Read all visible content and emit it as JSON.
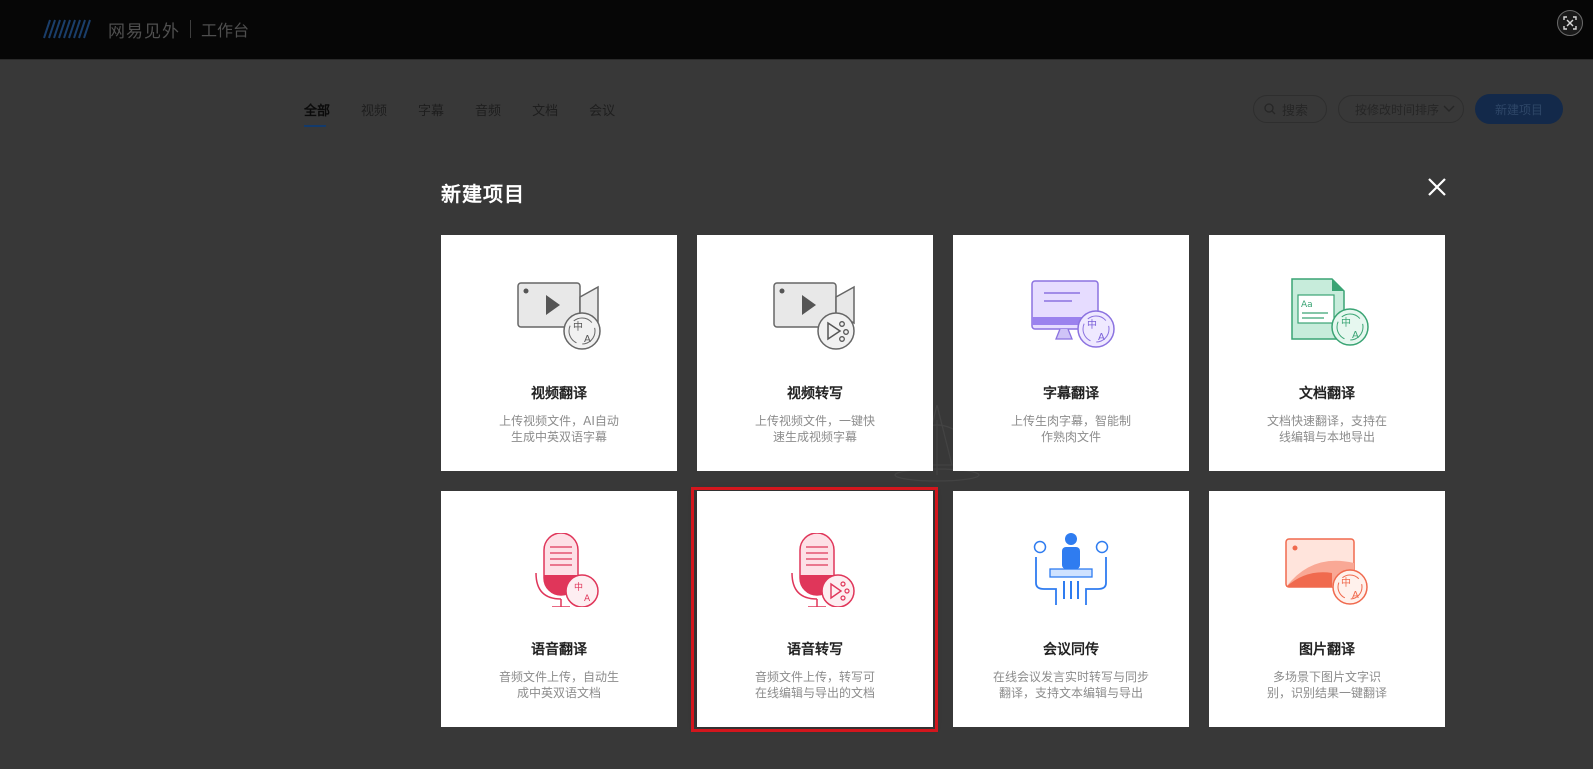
{
  "header": {
    "brand": "网易见外",
    "section": "工作台"
  },
  "tabs": [
    {
      "label": "全部",
      "active": true
    },
    {
      "label": "视频",
      "active": false
    },
    {
      "label": "字幕",
      "active": false
    },
    {
      "label": "音频",
      "active": false
    },
    {
      "label": "文档",
      "active": false
    },
    {
      "label": "会议",
      "active": false
    }
  ],
  "toolbar": {
    "search_label": "搜索",
    "sort_label": "按修改时间排序",
    "new_project_label": "新建项目"
  },
  "modal": {
    "title": "新建项目",
    "cards": [
      {
        "title": "视频翻译",
        "desc1": "上传视频文件，AI自动",
        "desc2": "生成中英双语字幕",
        "icon": "video-translate-icon"
      },
      {
        "title": "视频转写",
        "desc1": "上传视频文件，一键快",
        "desc2": "速生成视频字幕",
        "icon": "video-transcribe-icon"
      },
      {
        "title": "字幕翻译",
        "desc1": "上传生肉字幕，智能制",
        "desc2": "作熟肉文件",
        "icon": "subtitle-translate-icon"
      },
      {
        "title": "文档翻译",
        "desc1": "文档快速翻译，支持在",
        "desc2": "线编辑与本地导出",
        "icon": "document-translate-icon"
      },
      {
        "title": "语音翻译",
        "desc1": "音频文件上传，自动生",
        "desc2": "成中英双语文档",
        "icon": "audio-translate-icon"
      },
      {
        "title": "语音转写",
        "desc1": "音频文件上传，转写可",
        "desc2": "在线编辑与导出的文档",
        "icon": "audio-transcribe-icon"
      },
      {
        "title": "会议同传",
        "desc1": "在线会议发言实时转写与同步",
        "desc2": "翻译，支持文本编辑与导出",
        "icon": "meeting-interpret-icon"
      },
      {
        "title": "图片翻译",
        "desc1": "多场景下图片文字识",
        "desc2": "别，识别结果一键翻译",
        "icon": "image-translate-icon"
      }
    ]
  },
  "colors": {
    "highlight": "#d3161d",
    "overlay_bg": "#383838",
    "brand_blue": "#13294a"
  }
}
